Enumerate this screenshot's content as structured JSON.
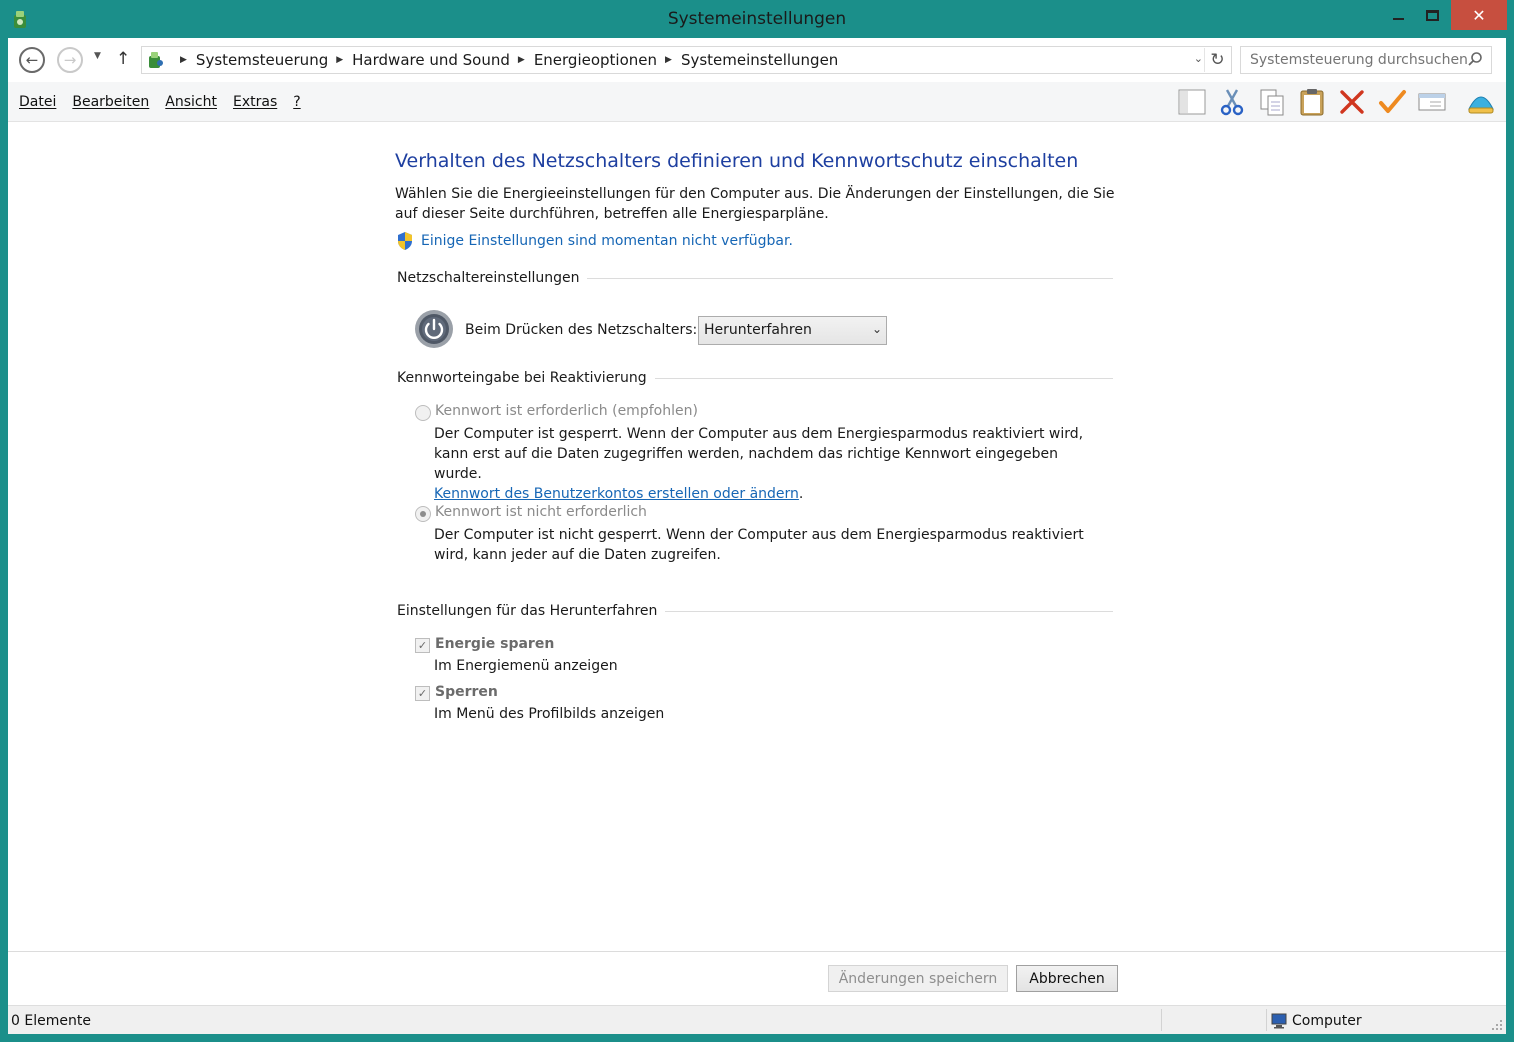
{
  "window": {
    "title": "Systemeinstellungen",
    "close_glyph": "✕"
  },
  "address": {
    "crumbs": [
      "Systemsteuerung",
      "Hardware und Sound",
      "Energieoptionen",
      "Systemeinstellungen"
    ],
    "search_placeholder": "Systemsteuerung durchsuchen"
  },
  "menu": [
    "Datei",
    "Bearbeiten",
    "Ansicht",
    "Extras",
    "?"
  ],
  "toolbar_icons": [
    "layout-icon",
    "cut-icon",
    "copy-icon",
    "paste-icon",
    "delete-icon",
    "check-icon",
    "properties-icon",
    "shell-icon"
  ],
  "page": {
    "title": "Verhalten des Netzschalters definieren und Kennwortschutz einschalten",
    "intro": "Wählen Sie die Energieeinstellungen für den Computer aus. Die Änderungen der Einstellungen, die Sie auf dieser Seite durchführen, betreffen alle Energiesparpläne.",
    "unavailable_link": "Einige Einstellungen sind momentan nicht verfügbar."
  },
  "power_button": {
    "group_title": "Netzschaltereinstellungen",
    "label": "Beim Drücken des Netzschalters:",
    "selected": "Herunterfahren"
  },
  "password": {
    "group_title": "Kennworteingabe bei Reaktivierung",
    "option1_label": "Kennwort ist erforderlich (empfohlen)",
    "option1_desc": "Der Computer ist gesperrt. Wenn der Computer aus dem Energiesparmodus reaktiviert wird, kann erst auf die Daten zugegriffen werden, nachdem das richtige Kennwort eingegeben wurde.",
    "option1_link": "Kennwort des Benutzerkontos erstellen oder ändern",
    "option1_link_suffix": ".",
    "option1_checked": false,
    "option2_label": "Kennwort ist nicht erforderlich",
    "option2_desc": "Der Computer ist nicht gesperrt. Wenn der Computer aus dem Energiesparmodus reaktiviert wird, kann jeder auf die Daten zugreifen.",
    "option2_checked": true
  },
  "shutdown": {
    "group_title": "Einstellungen für das Herunterfahren",
    "items": [
      {
        "label": "Energie sparen",
        "desc": "Im Energiemenü anzeigen",
        "checked": true
      },
      {
        "label": "Sperren",
        "desc": "Im Menü des Profilbilds anzeigen",
        "checked": true
      }
    ],
    "check_glyph": "✓"
  },
  "buttons": {
    "save": "Änderungen speichern",
    "cancel": "Abbrechen"
  },
  "status": {
    "items_count": "0 Elemente",
    "location": "Computer"
  },
  "colors": {
    "frame": "#1b8f8a",
    "close": "#c74f3f",
    "heading": "#1e3fa0",
    "link": "#1666b5"
  }
}
